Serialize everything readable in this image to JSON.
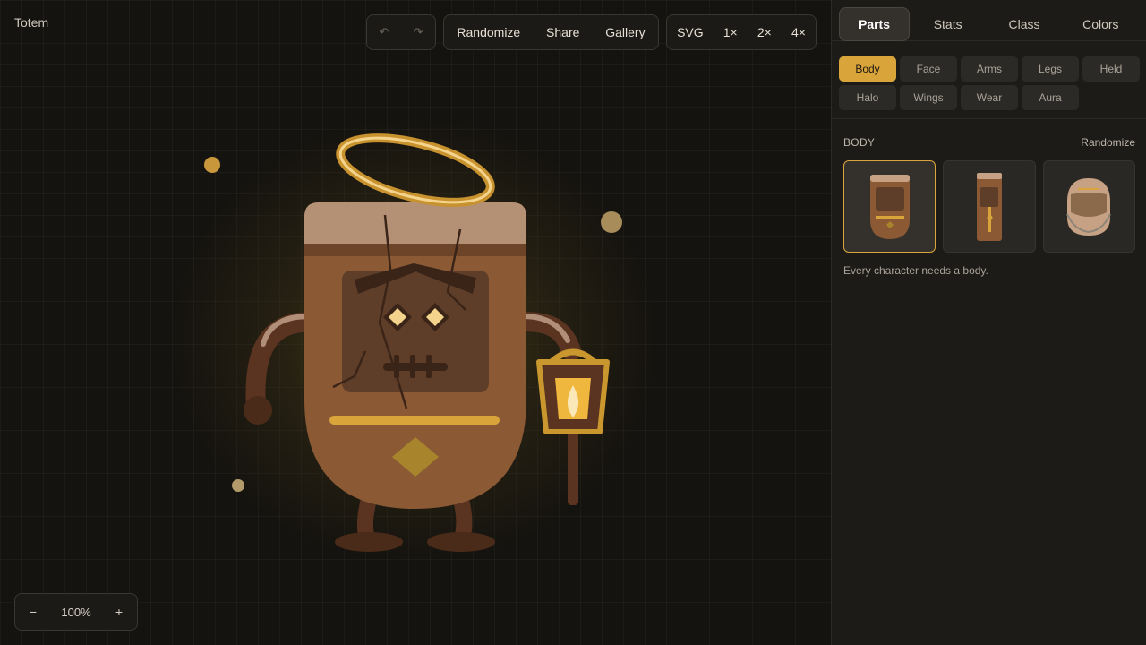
{
  "app": {
    "title": "Totem"
  },
  "toolbar": {
    "undo_icon": "undo-icon",
    "redo_icon": "redo-icon",
    "randomize": "Randomize",
    "share": "Share",
    "gallery": "Gallery",
    "svg": "SVG",
    "scale_1": "1×",
    "scale_2": "2×",
    "scale_4": "4×"
  },
  "zoom": {
    "minus": "−",
    "value": "100%",
    "plus": "+"
  },
  "tabs": [
    {
      "label": "Parts",
      "active": true
    },
    {
      "label": "Stats"
    },
    {
      "label": "Class"
    },
    {
      "label": "Colors"
    }
  ],
  "chips": [
    {
      "label": "Body",
      "active": true
    },
    {
      "label": "Face"
    },
    {
      "label": "Arms"
    },
    {
      "label": "Legs"
    },
    {
      "label": "Held"
    },
    {
      "label": "Halo"
    },
    {
      "label": "Wings"
    },
    {
      "label": "Wear"
    },
    {
      "label": "Aura"
    }
  ],
  "section": {
    "title": "BODY",
    "action": "Randomize",
    "hint": "Every character needs a body."
  },
  "colors": {
    "accent": "#d9a53b",
    "body": "#8b5a35",
    "cap": "#b49075",
    "face_plate": "#5e3e28",
    "dark": "#3a2418",
    "halo": "#e0b24a"
  }
}
